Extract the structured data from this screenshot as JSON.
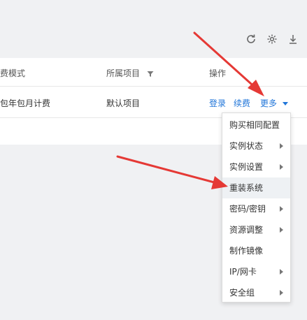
{
  "toolbar": {
    "icons": [
      "refresh-icon",
      "settings-icon",
      "download-icon"
    ]
  },
  "table": {
    "headers": {
      "billing": "计费模式",
      "project": "所属项目",
      "actions": "操作"
    },
    "row": {
      "billing": "按包年包月计费",
      "project": "默认项目",
      "login": "登录",
      "renew": "续费",
      "more": "更多"
    }
  },
  "menu": {
    "items": [
      {
        "label": "购买相同配置",
        "has_submenu": false
      },
      {
        "label": "实例状态",
        "has_submenu": true
      },
      {
        "label": "实例设置",
        "has_submenu": true
      },
      {
        "label": "重装系统",
        "has_submenu": false,
        "highlighted": true
      },
      {
        "label": "密码/密钥",
        "has_submenu": true
      },
      {
        "label": "资源调整",
        "has_submenu": true
      },
      {
        "label": "制作镜像",
        "has_submenu": false
      },
      {
        "label": "IP/网卡",
        "has_submenu": true
      },
      {
        "label": "安全组",
        "has_submenu": true
      }
    ]
  },
  "colors": {
    "link": "#2176d9",
    "annotation_arrow": "#e53935"
  }
}
